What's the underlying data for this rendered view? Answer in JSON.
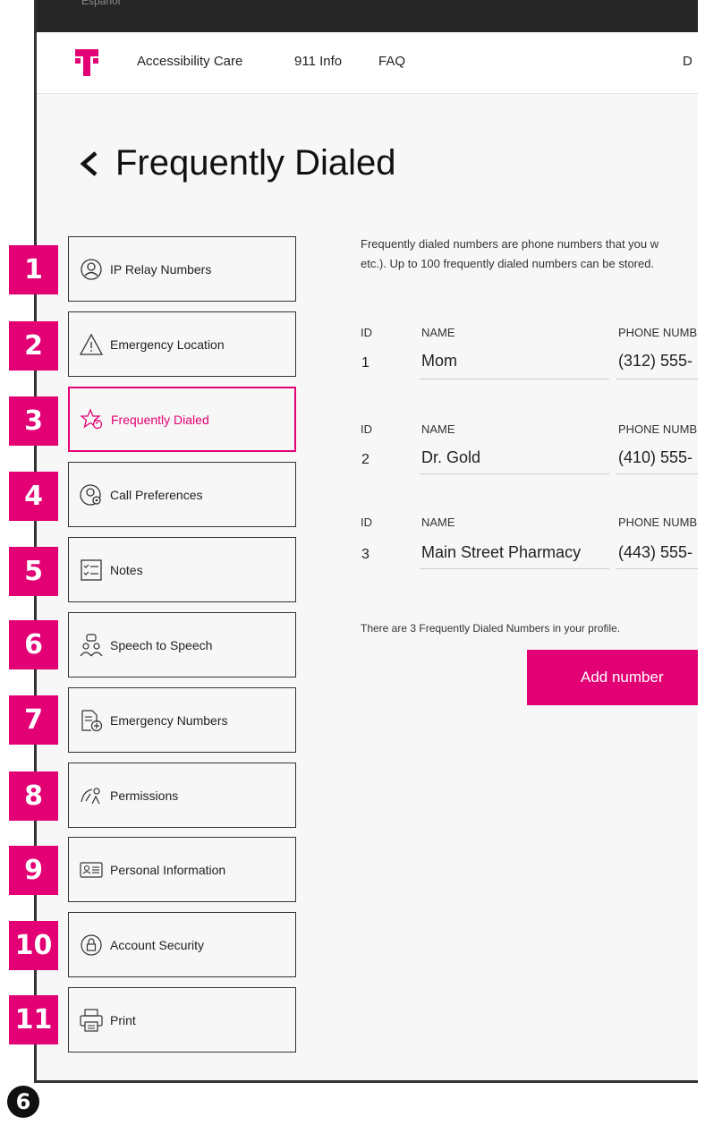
{
  "lang_bar": {
    "language_link": "Español"
  },
  "nav": {
    "links": [
      "Accessibility Care",
      "911 Info",
      "FAQ",
      "D"
    ]
  },
  "page": {
    "title": "Frequently Dialed"
  },
  "menu": [
    {
      "num": "1",
      "label": "IP Relay Numbers",
      "icon": "person-circle-icon"
    },
    {
      "num": "2",
      "label": "Emergency Location",
      "icon": "warning-triangle-icon"
    },
    {
      "num": "3",
      "label": "Frequently Dialed",
      "icon": "star-phone-icon",
      "active": true
    },
    {
      "num": "4",
      "label": "Call Preferences",
      "icon": "person-gear-icon"
    },
    {
      "num": "5",
      "label": "Notes",
      "icon": "checklist-icon"
    },
    {
      "num": "6",
      "label": "Speech to Speech",
      "icon": "people-speech-icon"
    },
    {
      "num": "7",
      "label": "Emergency Numbers",
      "icon": "document-plus-icon"
    },
    {
      "num": "8",
      "label": "Permissions",
      "icon": "gauge-person-icon"
    },
    {
      "num": "9",
      "label": "Personal Information",
      "icon": "id-card-icon"
    },
    {
      "num": "10",
      "label": "Account Security",
      "icon": "lock-circle-icon"
    },
    {
      "num": "11",
      "label": "Print",
      "icon": "printer-icon"
    }
  ],
  "content": {
    "intro_line1": "Frequently dialed numbers are phone numbers that you w",
    "intro_line2": "etc.). Up to 100 frequently dialed numbers can be stored.",
    "headers": {
      "id": "ID",
      "name": "NAME",
      "phone": "PHONE NUMBE"
    },
    "entries": [
      {
        "id": "1",
        "name": "Mom",
        "phone": "(312) 555-"
      },
      {
        "id": "2",
        "name": "Dr. Gold",
        "phone": "(410) 555-"
      },
      {
        "id": "3",
        "name": "Main Street Pharmacy",
        "phone": "(443) 555-"
      }
    ],
    "count_text": "There are 3 Frequently Dialed Numbers in your profile.",
    "add_button": "Add number"
  },
  "step_marker": "6",
  "colors": {
    "accent": "#e20074",
    "badge": "#e20074",
    "header_bar": "#262626"
  }
}
